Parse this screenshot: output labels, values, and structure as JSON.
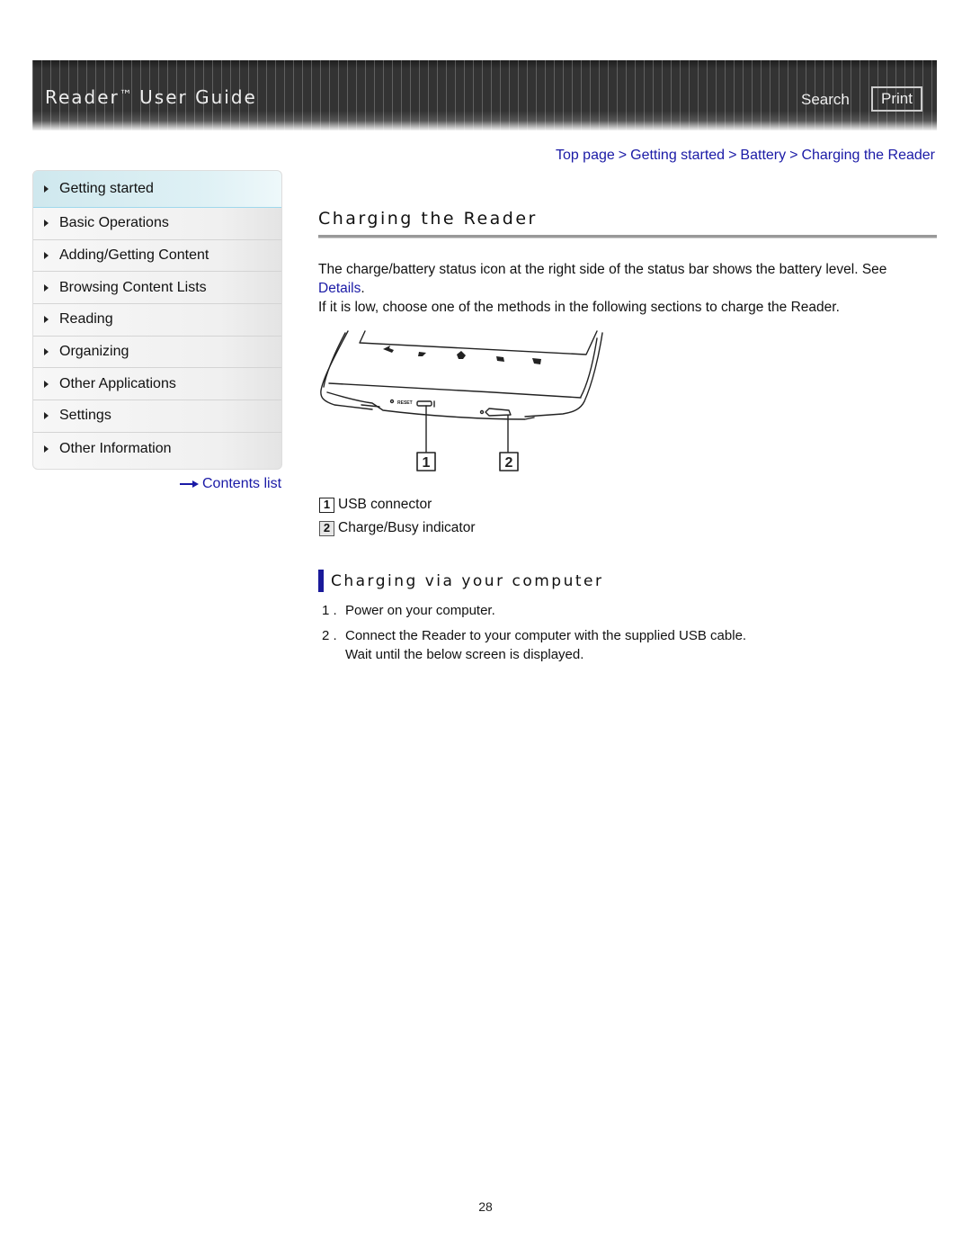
{
  "header": {
    "title": "Reader",
    "trademark": "™",
    "title_rest": "User Guide",
    "search_label": "Search",
    "print_label": "Print"
  },
  "sidebar": {
    "items": [
      {
        "label": "Getting started",
        "active": true
      },
      {
        "label": "Basic Operations"
      },
      {
        "label": "Adding/Getting Content"
      },
      {
        "label": "Browsing Content Lists"
      },
      {
        "label": "Reading"
      },
      {
        "label": "Organizing"
      },
      {
        "label": "Other Applications"
      },
      {
        "label": "Settings"
      },
      {
        "label": "Other Information"
      }
    ],
    "contents_link": "Contents list"
  },
  "breadcrumb": {
    "items": [
      "Top page",
      "Getting started",
      "Battery",
      "Charging the Reader"
    ],
    "separator": ">"
  },
  "main": {
    "title": "Charging the Reader",
    "intro_line1": "The charge/battery status icon at the right side of the status bar shows the battery level. See",
    "details_link": "Details",
    "details_suffix": ".",
    "intro_line2": "If it is low, choose one of the methods in the following sections to charge the Reader.",
    "figure": {
      "callouts": [
        "1",
        "2"
      ],
      "port_label": "RESET"
    },
    "legend": [
      {
        "num": "1",
        "label": "USB connector"
      },
      {
        "num": "2",
        "label": "Charge/Busy indicator"
      }
    ],
    "section_heading": "Charging via your computer",
    "steps": [
      {
        "num": "1 .",
        "text": "Power on your computer."
      },
      {
        "num": "2 .",
        "text": "Connect the Reader to your computer with the supplied USB cable.",
        "text2": "Wait until the below screen is displayed."
      }
    ]
  },
  "page_number": "28",
  "colors": {
    "link": "#1a1aa6",
    "header_bg": "#333333",
    "section_bar": "#1a1a9a",
    "active_nav": "#dff1f5"
  }
}
